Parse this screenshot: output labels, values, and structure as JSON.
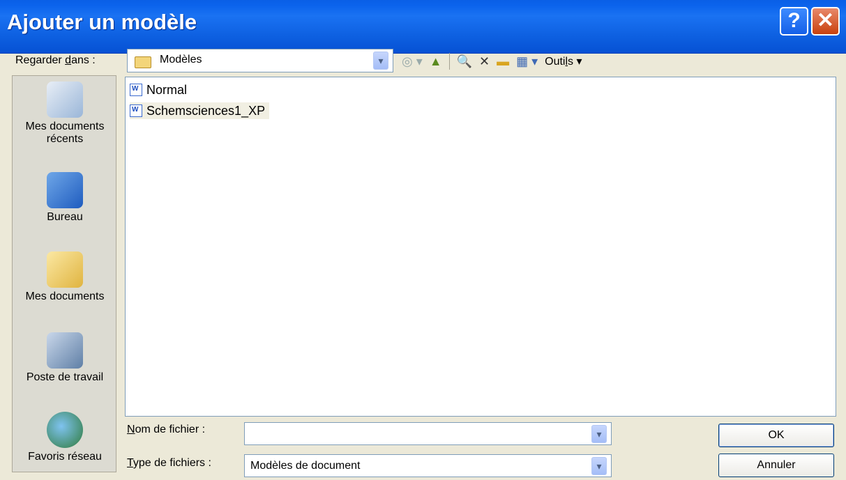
{
  "dialog": {
    "title": "Ajouter un modèle",
    "help_glyph": "?",
    "close_glyph": "✕"
  },
  "lookin": {
    "label_pre": "Regarder ",
    "label_ul": "d",
    "label_post": "ans :",
    "value": "Modèles"
  },
  "toolbar": {
    "tools_label_pre": "Outi",
    "tools_label_ul": "l",
    "tools_label_post": "s",
    "delete_glyph": "✕"
  },
  "places": [
    {
      "label": "Mes documents récents",
      "icon": "recent-documents-icon"
    },
    {
      "label": "Bureau",
      "icon": "desktop-icon"
    },
    {
      "label": "Mes documents",
      "icon": "my-documents-icon"
    },
    {
      "label": "Poste de travail",
      "icon": "my-computer-icon"
    },
    {
      "label": "Favoris réseau",
      "icon": "network-places-icon"
    }
  ],
  "files": [
    "Normal",
    "Schemsciences1_XP"
  ],
  "filename": {
    "label_ul": "N",
    "label_rest": "om de fichier :",
    "value": ""
  },
  "filetype": {
    "label_ul": "T",
    "label_rest": "ype de fichiers :",
    "value": "Modèles de document"
  },
  "buttons": {
    "ok": "OK",
    "cancel": "Annuler"
  }
}
